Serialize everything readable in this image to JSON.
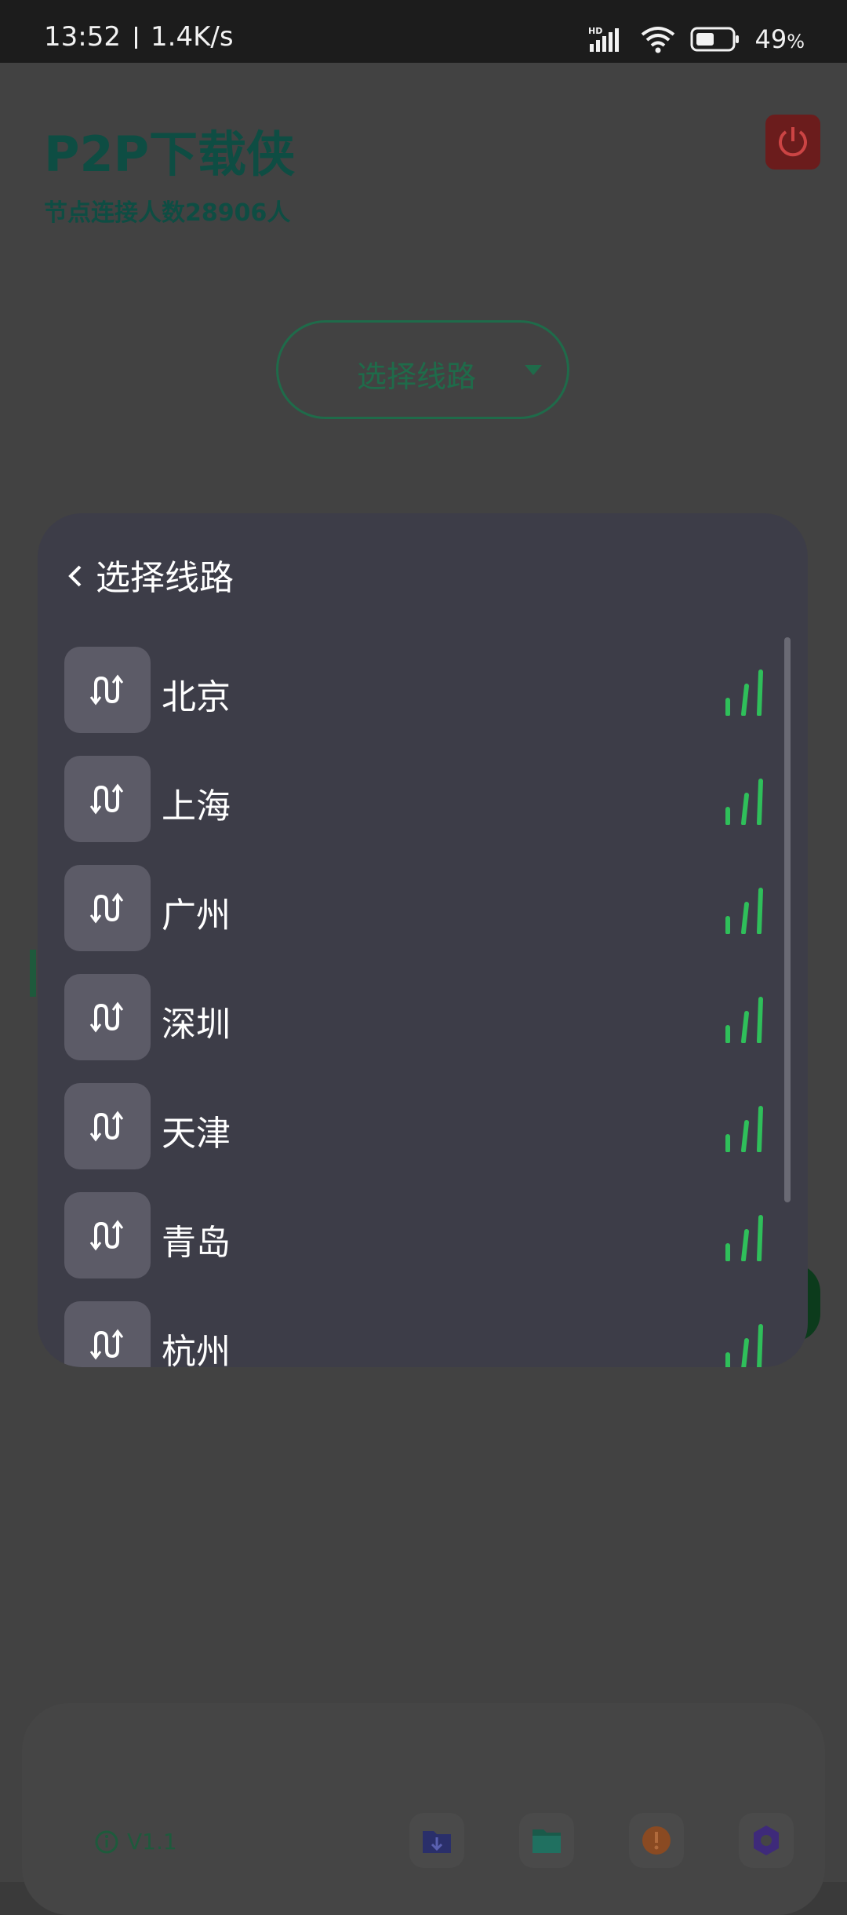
{
  "status_bar": {
    "time": "13:52",
    "net_speed": "1.4K/s",
    "battery": "49",
    "battery_unit": "%",
    "icons": [
      "hd-signal-icon",
      "wifi-icon",
      "battery-icon"
    ]
  },
  "app": {
    "title": "P2P下载侠",
    "subtitle": "节点连接人数28906人",
    "route_selector_label": "选择线路",
    "version": "V1.1",
    "accent_color": "#1f6b4a"
  },
  "modal": {
    "title": "选择线路",
    "routes": [
      {
        "name": "北京"
      },
      {
        "name": "上海"
      },
      {
        "name": "广州"
      },
      {
        "name": "深圳"
      },
      {
        "name": "天津"
      },
      {
        "name": "青岛"
      },
      {
        "name": "杭州"
      }
    ],
    "signal_color": "#2fbf5a",
    "route_icon": "route-icon"
  },
  "bottom_nav": {
    "icons": [
      "download-folder-icon",
      "folder-icon",
      "warning-icon",
      "settings-icon"
    ]
  }
}
